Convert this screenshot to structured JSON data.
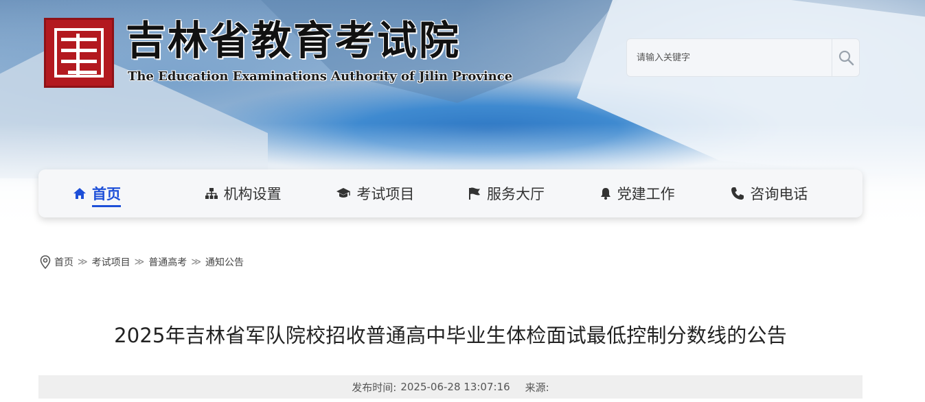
{
  "header": {
    "title": "吉林省教育考试院",
    "subtitle": "The Education Examinations Authority of Jilin Province",
    "logo_icon": "jilin-edu-logo"
  },
  "search": {
    "placeholder": "请输入关键字",
    "icon": "search-icon"
  },
  "nav": {
    "items": [
      {
        "label": "首页",
        "icon": "home-icon",
        "active": true
      },
      {
        "label": "机构设置",
        "icon": "org-chart-icon",
        "active": false
      },
      {
        "label": "考试项目",
        "icon": "graduation-cap-icon",
        "active": false
      },
      {
        "label": "服务大厅",
        "icon": "flag-icon",
        "active": false
      },
      {
        "label": "党建工作",
        "icon": "bell-icon",
        "active": false
      },
      {
        "label": "咨询电话",
        "icon": "phone-icon",
        "active": false
      }
    ],
    "accent": "#1d4fd8"
  },
  "breadcrumb": {
    "icon": "location-pin-icon",
    "items": [
      "首页",
      "考试项目",
      "普通高考",
      "通知公告"
    ],
    "separator": "≫"
  },
  "article": {
    "title": "2025年吉林省军队院校招收普通高中毕业生体检面试最低控制分数线的公告",
    "publish_label": "发布时间:",
    "publish_time": "2025-06-28 13:07:16",
    "source_label": "来源:"
  }
}
